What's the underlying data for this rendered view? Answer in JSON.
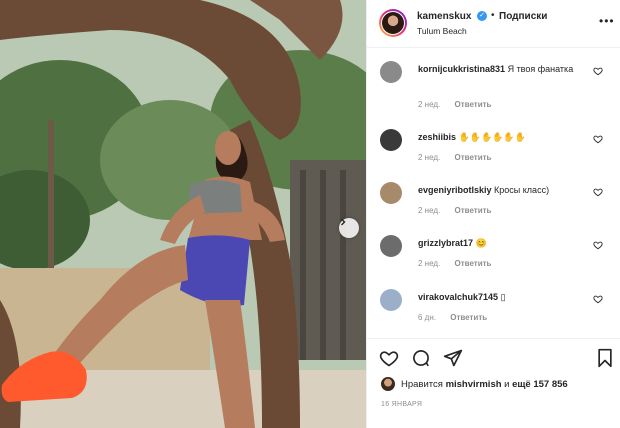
{
  "post": {
    "username": "kamenskux",
    "dot": "•",
    "follow_label": "Подписки",
    "location": "Tulum Beach",
    "more": "•••"
  },
  "comments": [
    {
      "user": "kornijcukkristina831",
      "text": "Я твоя фанатка",
      "time": "2 нед.",
      "reply": "Ответить",
      "avatar_color": "#8a8a8a"
    },
    {
      "user": "zeshiibis",
      "text": "✋✋✋✋✋✋",
      "time": "2 нед.",
      "reply": "Ответить",
      "avatar_color": "#3a3a3a"
    },
    {
      "user": "evgeniyribotlskiy",
      "text": "Кросы класс)",
      "time": "2 нед.",
      "reply": "Ответить",
      "avatar_color": "#a68a6a"
    },
    {
      "user": "grizzlybrat17",
      "text": "😊",
      "time": "2 нед.",
      "reply": "Ответить",
      "avatar_color": "#6c6c6c"
    },
    {
      "user": "virakovalchuk7145",
      "text": "▯",
      "time": "6 дн.",
      "reply": "Ответить",
      "avatar_color": "#9bb0c8"
    }
  ],
  "likes": {
    "prefix": "Нравится",
    "user": "mishvirmish",
    "connector": "и",
    "count": "ещё 157 856"
  },
  "date": "16 ЯНВАРЯ",
  "icons": [
    "heart-icon",
    "comment-icon",
    "share-icon",
    "bookmark-icon",
    "chevron-right-icon",
    "verified-badge-icon"
  ],
  "colors": {
    "verified": "#3897f0",
    "meta": "#8e8e8e",
    "text": "#262626"
  }
}
